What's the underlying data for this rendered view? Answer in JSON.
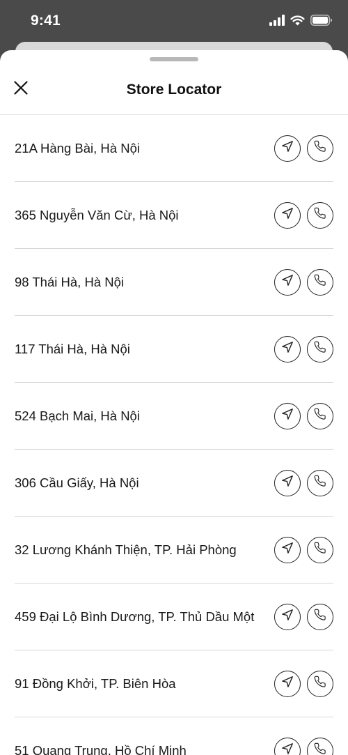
{
  "status_bar": {
    "time": "9:41"
  },
  "header": {
    "title": "Store Locator",
    "close_icon": "close-icon"
  },
  "stores": [
    {
      "address": "21A Hàng Bài, Hà Nội"
    },
    {
      "address": "365 Nguyễn Văn Cừ, Hà Nội"
    },
    {
      "address": "98 Thái Hà, Hà Nội"
    },
    {
      "address": "117 Thái Hà, Hà Nội"
    },
    {
      "address": "524 Bạch Mai, Hà Nội"
    },
    {
      "address": "306 Cầu Giấy, Hà Nội"
    },
    {
      "address": "32 Lương Khánh Thiện, TP. Hải Phòng"
    },
    {
      "address": "459 Đại Lộ Bình Dương, TP. Thủ Dầu Một"
    },
    {
      "address": "91 Đồng Khởi, TP. Biên Hòa"
    },
    {
      "address": "51 Quang Trung, Hồ Chí Minh"
    }
  ],
  "row_actions": {
    "directions_icon": "navigation-arrow-icon",
    "call_icon": "phone-icon"
  },
  "colors": {
    "status_bar_background": "#4a4a4a",
    "sheet_background": "#ffffff",
    "text": "#1a1a1a",
    "divider": "#d6d6d6"
  }
}
